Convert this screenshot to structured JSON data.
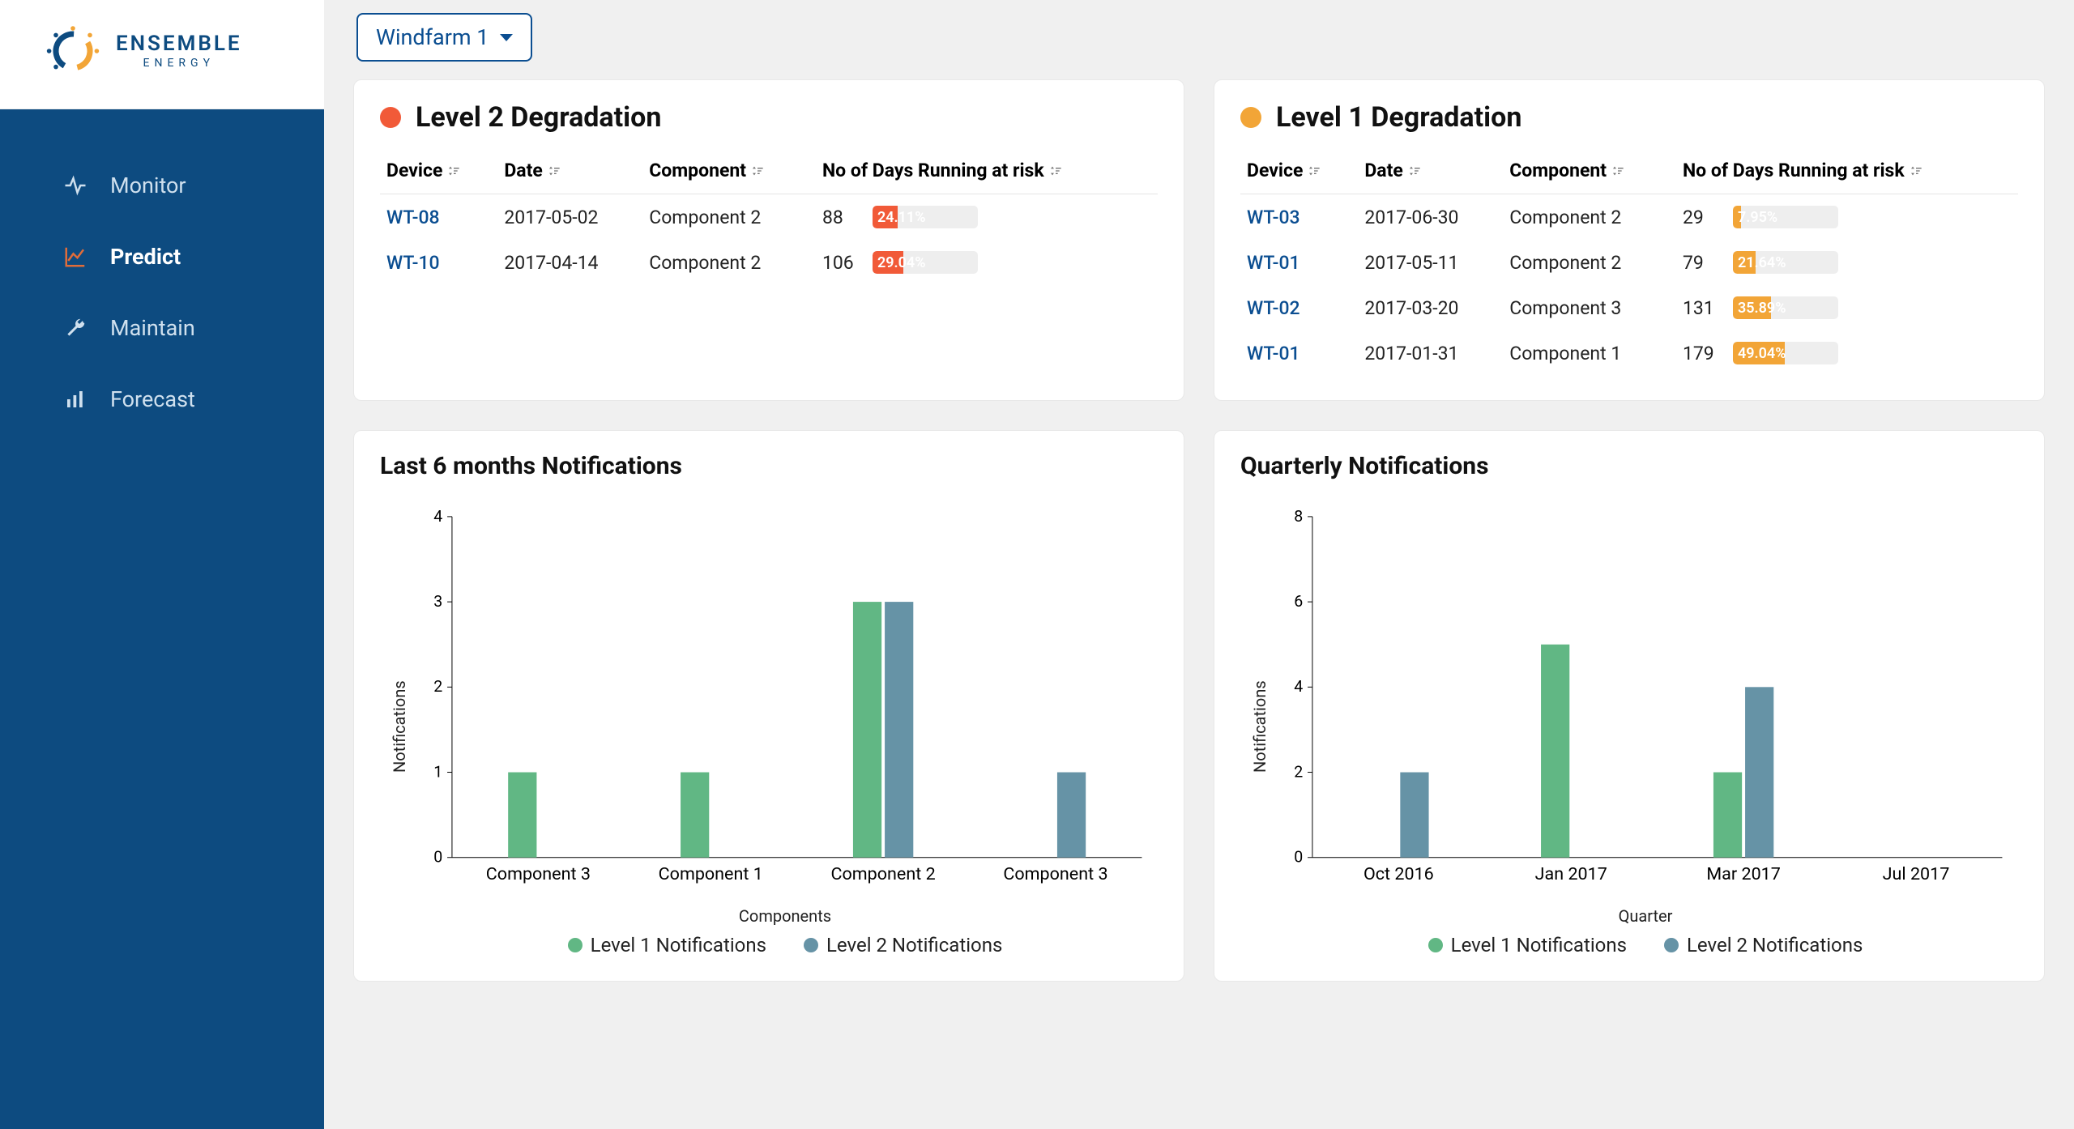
{
  "brand": {
    "name_top": "ENSEMBLE",
    "name_bottom": "ENERGY"
  },
  "nav": {
    "items": [
      {
        "key": "monitor",
        "label": "Monitor",
        "icon": "activity-icon"
      },
      {
        "key": "predict",
        "label": "Predict",
        "icon": "line-chart-icon",
        "active": true
      },
      {
        "key": "maintain",
        "label": "Maintain",
        "icon": "wrench-icon"
      },
      {
        "key": "forecast",
        "label": "Forecast",
        "icon": "bar-chart-icon"
      }
    ]
  },
  "farm_selector": {
    "label": "Windfarm 1"
  },
  "tables": {
    "columns": {
      "device": "Device",
      "date": "Date",
      "component": "Component",
      "risk": "No of Days Running at risk"
    },
    "level2": {
      "title": "Level 2 Degradation",
      "color": "red",
      "rows": [
        {
          "device": "WT-08",
          "date": "2017-05-02",
          "component": "Component 2",
          "days": 88,
          "pct": 24.11,
          "pct_label": "24.11%"
        },
        {
          "device": "WT-10",
          "date": "2017-04-14",
          "component": "Component 2",
          "days": 106,
          "pct": 29.04,
          "pct_label": "29.04%"
        }
      ]
    },
    "level1": {
      "title": "Level 1 Degradation",
      "color": "orange",
      "rows": [
        {
          "device": "WT-03",
          "date": "2017-06-30",
          "component": "Component 2",
          "days": 29,
          "pct": 7.95,
          "pct_label": "7.95%"
        },
        {
          "device": "WT-01",
          "date": "2017-05-11",
          "component": "Component 2",
          "days": 79,
          "pct": 21.64,
          "pct_label": "21.64%"
        },
        {
          "device": "WT-02",
          "date": "2017-03-20",
          "component": "Component 3",
          "days": 131,
          "pct": 35.89,
          "pct_label": "35.89%"
        },
        {
          "device": "WT-01",
          "date": "2017-01-31",
          "component": "Component 1",
          "days": 179,
          "pct": 49.04,
          "pct_label": "49.04%"
        }
      ]
    }
  },
  "legend": {
    "l1": "Level 1 Notifications",
    "l2": "Level 2 Notifications"
  },
  "chart_data": [
    {
      "id": "six_months",
      "title": "Last 6 months Notifications",
      "type": "bar",
      "xlabel": "Components",
      "ylabel": "Notifications",
      "ylim": [
        0,
        4
      ],
      "yticks": [
        0,
        1,
        2,
        3,
        4
      ],
      "categories": [
        "Component 3",
        "Component 1",
        "Component 2",
        "Component 3"
      ],
      "series": [
        {
          "name": "Level 1 Notifications",
          "color": "#61b784",
          "values": [
            1,
            1,
            3,
            0
          ]
        },
        {
          "name": "Level 2 Notifications",
          "color": "#6693a6",
          "values": [
            0,
            0,
            3,
            1
          ]
        }
      ]
    },
    {
      "id": "quarterly",
      "title": "Quarterly Notifications",
      "type": "bar",
      "xlabel": "Quarter",
      "ylabel": "Notifications",
      "ylim": [
        0,
        8
      ],
      "yticks": [
        0,
        2,
        4,
        6,
        8
      ],
      "categories": [
        "Oct 2016",
        "Jan 2017",
        "Mar 2017",
        "Jul 2017"
      ],
      "series": [
        {
          "name": "Level 1 Notifications",
          "color": "#61b784",
          "values": [
            0,
            5,
            2,
            0
          ]
        },
        {
          "name": "Level 2 Notifications",
          "color": "#6693a6",
          "values": [
            2,
            0,
            4,
            0
          ]
        }
      ]
    }
  ]
}
